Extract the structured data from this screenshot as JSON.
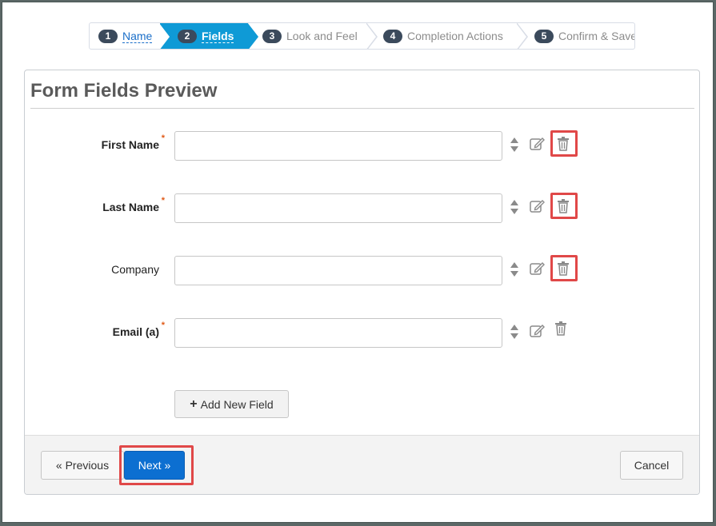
{
  "wizard": {
    "steps": [
      {
        "num": "1",
        "label": "Name"
      },
      {
        "num": "2",
        "label": "Fields"
      },
      {
        "num": "3",
        "label": "Look and Feel"
      },
      {
        "num": "4",
        "label": "Completion Actions"
      },
      {
        "num": "5",
        "label": "Confirm & Save"
      }
    ],
    "active_step": 2
  },
  "panel": {
    "title": "Form Fields Preview"
  },
  "fields": [
    {
      "label": "First Name",
      "required": true,
      "value": ""
    },
    {
      "label": "Last Name",
      "required": true,
      "value": ""
    },
    {
      "label": "Company",
      "required": false,
      "value": ""
    },
    {
      "label": "Email (a)",
      "required": true,
      "value": ""
    }
  ],
  "required_marker": "*",
  "icons": {
    "sort": "sort-icon",
    "edit": "edit-icon",
    "delete": "trash-icon",
    "add": "plus-icon"
  },
  "add_field_label": "Add New Field",
  "add_field_plus": "+",
  "footer": {
    "previous_label": "« Previous",
    "next_label": "Next »",
    "cancel_label": "Cancel"
  },
  "colors": {
    "accent": "#0f9ad6",
    "primary_button": "#0c6fd1",
    "highlight": "#e04848",
    "required": "#e05a18"
  }
}
